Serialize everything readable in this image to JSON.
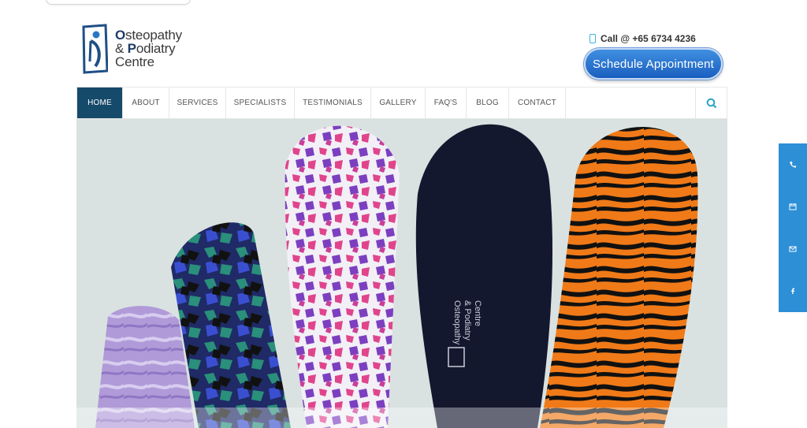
{
  "logo": {
    "line1": "Osteopathy",
    "line2": "& Podiatry",
    "line3": "Centre"
  },
  "header": {
    "call_text": "Call @ +65 6734 4236",
    "schedule_label": "Schedule Appointment"
  },
  "nav": {
    "items": [
      "HOME",
      "ABOUT",
      "SERVICES",
      "SPECIALISTS",
      "TESTIMONIALS",
      "GALLERY",
      "FAQ'S",
      "BLOG",
      "CONTACT"
    ],
    "active": "HOME"
  },
  "hero": {
    "insole_text_line1": "Osteopathy",
    "insole_text_line2": "& Podiatry",
    "insole_text_line3": "Centre"
  },
  "icons": [
    "phone-icon",
    "calendar-icon",
    "mail-icon",
    "facebook-icon",
    "search-icon"
  ],
  "colors": {
    "nav_active": "#164a6b",
    "side_bar": "#2d8fd6",
    "schedule_button": "#2b75d3"
  }
}
